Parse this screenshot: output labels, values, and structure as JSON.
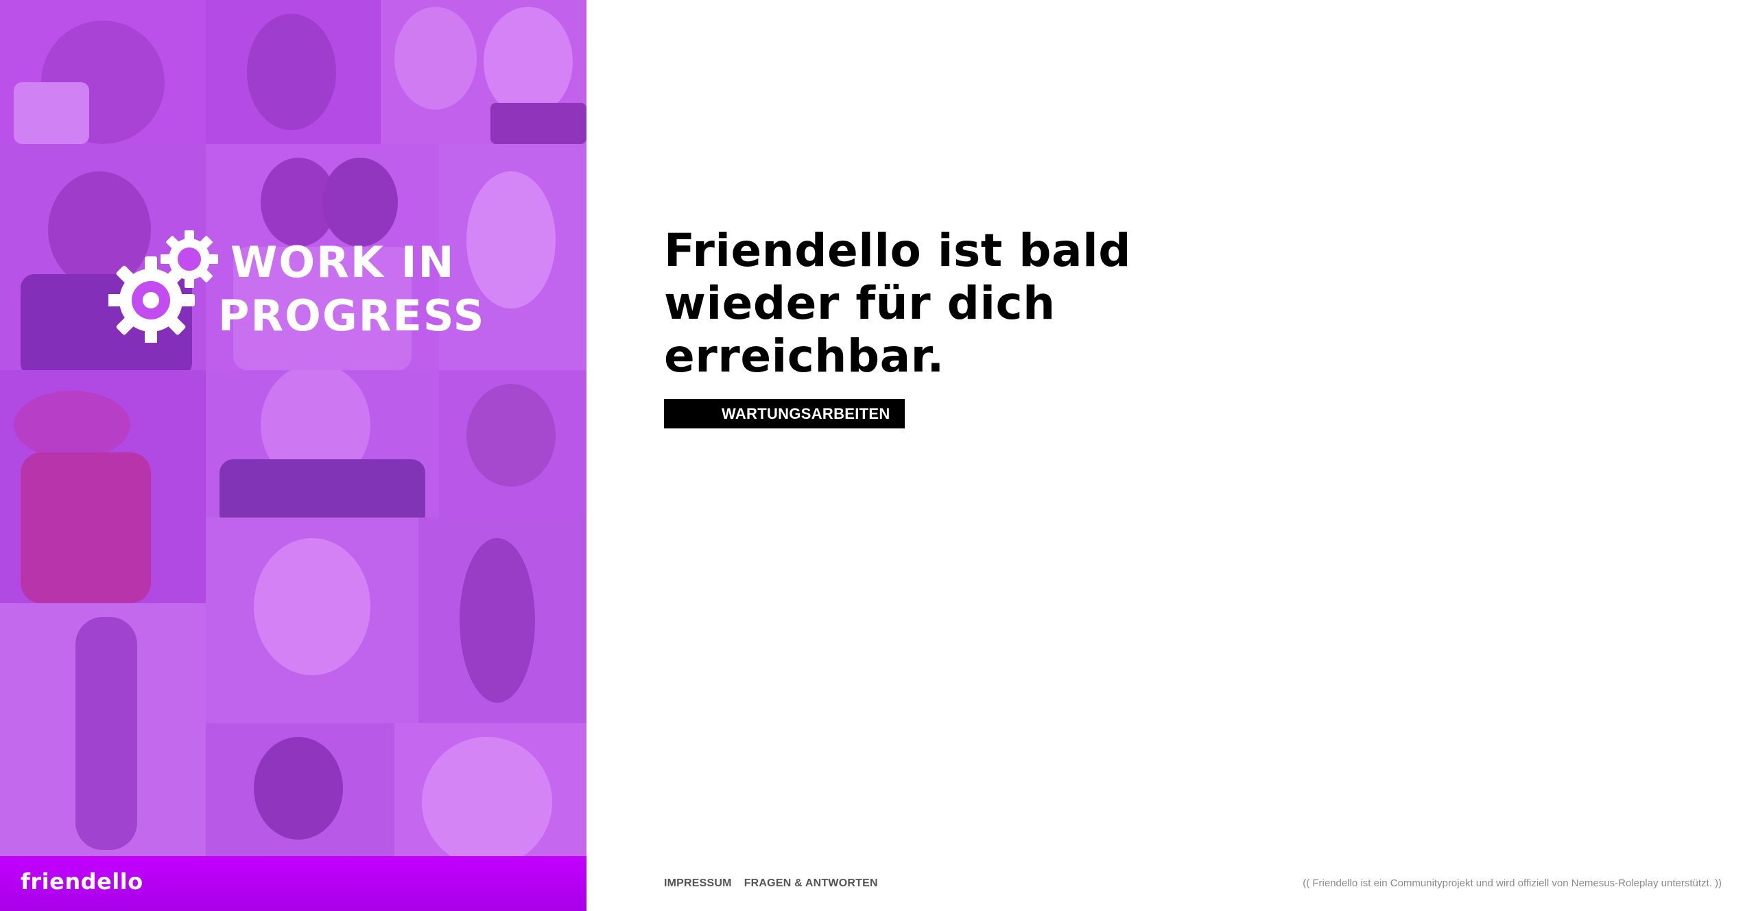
{
  "left_panel": {
    "wip": {
      "line1": "WORK IN",
      "line2": "PROGRESS"
    },
    "brand": "friendello"
  },
  "main": {
    "headline": "Friendello ist bald wieder für dich erreichbar.",
    "badge": "WARTUNGSARBEITEN"
  },
  "footer": {
    "links": [
      "IMPRESSUM",
      "FRAGEN & ANTWORTEN"
    ],
    "disclaimer": "(( Friendello ist ein Communityprojekt und wird offiziell von Nemesus-Roleplay unterstützt. ))"
  },
  "colors": {
    "accent": "#c300ff",
    "panel_overlay": "#be3cf5",
    "headline": "#000000",
    "badge_bg": "#000000"
  },
  "icons": [
    "gears-icon"
  ]
}
